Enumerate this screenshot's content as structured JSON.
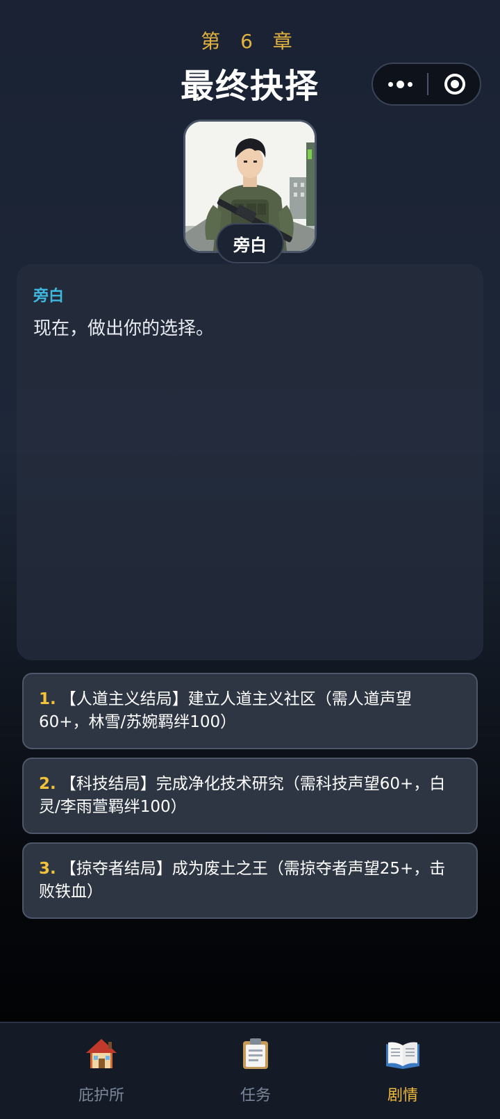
{
  "header": {
    "chapter": "第 6 章",
    "title": "最终抉择"
  },
  "capsule": {
    "more_icon": "more-dots-icon",
    "close_icon": "target-close-icon"
  },
  "portrait": {
    "icon": "soldier-portrait",
    "speaker_tag": "旁白"
  },
  "dialogue": {
    "speaker": "旁白",
    "text": "现在，做出你的选择。",
    "speaker_color": "#3fb8e0"
  },
  "choices": [
    {
      "num": "1.",
      "text": "【人道主义结局】建立人道主义社区（需人道声望60+，林雪/苏婉羁绊100）"
    },
    {
      "num": "2.",
      "text": "【科技结局】完成净化技术研究（需科技声望60+，白灵/李雨萱羁绊100）"
    },
    {
      "num": "3.",
      "text": "【掠夺者结局】成为废土之王（需掠夺者声望25+，击败铁血）"
    }
  ],
  "nav": {
    "items": [
      {
        "label": "庇护所",
        "icon": "house-icon"
      },
      {
        "label": "任务",
        "icon": "clipboard-icon"
      },
      {
        "label": "剧情",
        "icon": "open-book-icon"
      }
    ],
    "active_index": 2,
    "active_color": "#f0b93a"
  }
}
